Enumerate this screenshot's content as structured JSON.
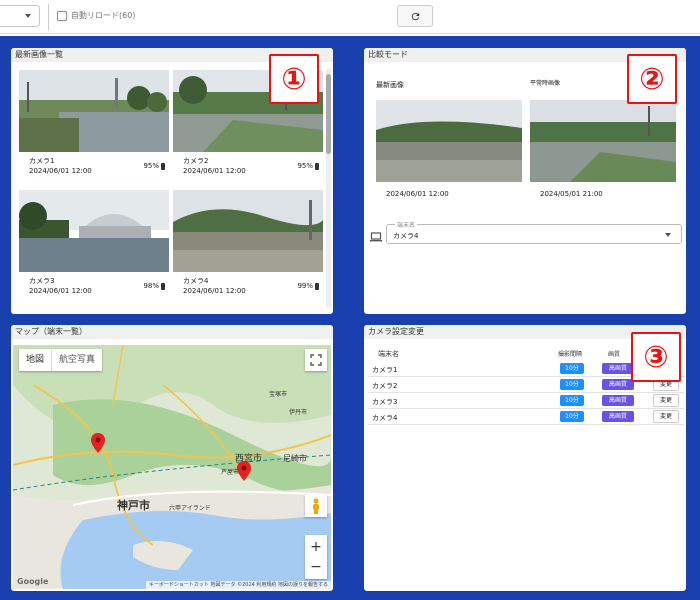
{
  "toolbar": {
    "auto_reload_label": "自動リロード(60)",
    "refresh_icon": "refresh-icon"
  },
  "badges": [
    "①",
    "②",
    "③"
  ],
  "images_panel": {
    "title": "最新画像一覧",
    "cameras": [
      {
        "name": "カメラ1",
        "datetime": "2024/06/01 12:00",
        "battery": "95%"
      },
      {
        "name": "カメラ2",
        "datetime": "2024/06/01 12:00",
        "battery": "95%"
      },
      {
        "name": "カメラ3",
        "datetime": "2024/06/01 12:00",
        "battery": "98%"
      },
      {
        "name": "カメラ4",
        "datetime": "2024/06/01 12:00",
        "battery": "99%"
      }
    ]
  },
  "compare_panel": {
    "title": "比較モード",
    "latest_label": "最新画像",
    "normal_label": "平常時画像",
    "latest_date": "2024/06/01 12:00",
    "normal_date": "2024/05/01 21:00",
    "terminal_legend": "端末名",
    "terminal_value": "カメラ4"
  },
  "map_panel": {
    "title": "マップ（端末一覧）",
    "map_button": "地図",
    "satellite_button": "航空写真",
    "zoom_in": "+",
    "zoom_out": "−",
    "labels": {
      "kobe": "神戸市",
      "nishinomiya": "西宮市",
      "amagasaki": "尼崎市",
      "takarazuka": "宝塚市",
      "itami": "伊丹市",
      "ashiya": "芦屋市",
      "rokko": "六甲アイランド"
    },
    "google": "Google",
    "footer": "キーボードショートカット  地図データ ©2024  利用規約  地図の誤りを報告する"
  },
  "settings_panel": {
    "title": "カメラ設定変更",
    "headers": {
      "terminal": "端末名",
      "interval": "撮影間隔",
      "quality": "画質"
    },
    "rows": [
      {
        "name": "カメラ1",
        "interval": "10分",
        "quality": "高画質",
        "action": "変更"
      },
      {
        "name": "カメラ2",
        "interval": "10分",
        "quality": "高画質",
        "action": "変更"
      },
      {
        "name": "カメラ3",
        "interval": "10分",
        "quality": "高画質",
        "action": "変更"
      },
      {
        "name": "カメラ4",
        "interval": "10分",
        "quality": "高画質",
        "action": "変更"
      }
    ]
  },
  "colors": {
    "background": "#1a3fae",
    "badge": "#e11111",
    "interval_chip": "#1e90ff",
    "quality_chip": "#6a52e6",
    "map_pin": "#e52222"
  }
}
